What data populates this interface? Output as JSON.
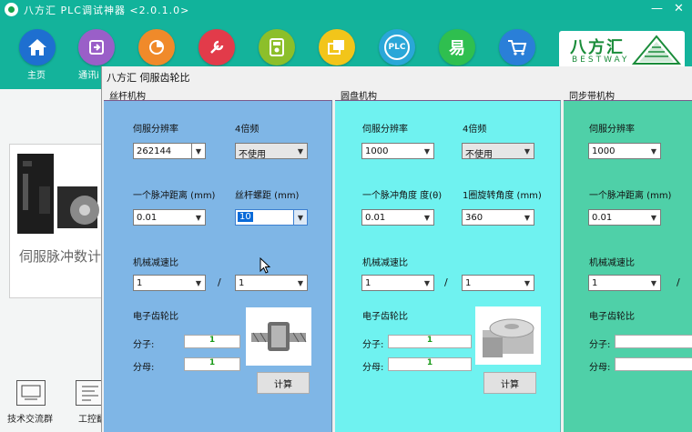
{
  "window": {
    "title": "八方汇  PLC调试神器 <2.0.1.0>"
  },
  "toolbar": {
    "home_label": "主页",
    "comm_label": "通讯i"
  },
  "brand": {
    "name_cn": "八方汇",
    "name_en": "BESTWAY"
  },
  "left": {
    "motor_text": "伺服脉冲数计",
    "bottom_items": [
      "技术交流群",
      "工控翻"
    ]
  },
  "dialog": {
    "title": "八方汇 伺服齿轮比",
    "sections": [
      {
        "title": "丝杆机构",
        "resolution_label": "伺服分辨率",
        "resolution_value": "262144",
        "freq_label": "4倍频",
        "freq_value": "不使用",
        "pulse_label": "一个脉冲距离 (mm)",
        "pulse_value": "0.01",
        "pitch_label": "丝杆螺距 (mm)",
        "pitch_value": "10",
        "ratio_label": "机械减速比",
        "ratio_a": "1",
        "ratio_b": "1",
        "gear_label": "电子齿轮比",
        "num_label": "分子:",
        "num_value": "1",
        "den_label": "分母:",
        "den_value": "1",
        "calc_label": "计算"
      },
      {
        "title": "圆盘机构",
        "resolution_label": "伺服分辨率",
        "resolution_value": "1000",
        "freq_label": "4倍频",
        "freq_value": "不使用",
        "pulse_label": "一个脉冲角度 度(θ)",
        "pulse_value": "0.01",
        "rot_label": "1圈旋转角度 (mm)",
        "rot_value": "360",
        "ratio_label": "机械减速比",
        "ratio_a": "1",
        "ratio_b": "1",
        "gear_label": "电子齿轮比",
        "num_label": "分子:",
        "num_value": "1",
        "den_label": "分母:",
        "den_value": "1",
        "calc_label": "计算"
      },
      {
        "title": "同步带机构",
        "resolution_label": "伺服分辨率",
        "resolution_value": "1000",
        "pulse_label": "一个脉冲距离 (mm)",
        "pulse_value": "0.01",
        "ratio_label": "机械减速比",
        "ratio_a": "1",
        "gear_label": "电子齿轮比",
        "num_label": "分子:",
        "den_label": "分母:"
      }
    ],
    "slash": "/"
  },
  "colors": {
    "accent": "#14b39b",
    "section1": "#7fb6e6",
    "section2": "#6ff2f0",
    "section3": "#4fd0a8"
  }
}
